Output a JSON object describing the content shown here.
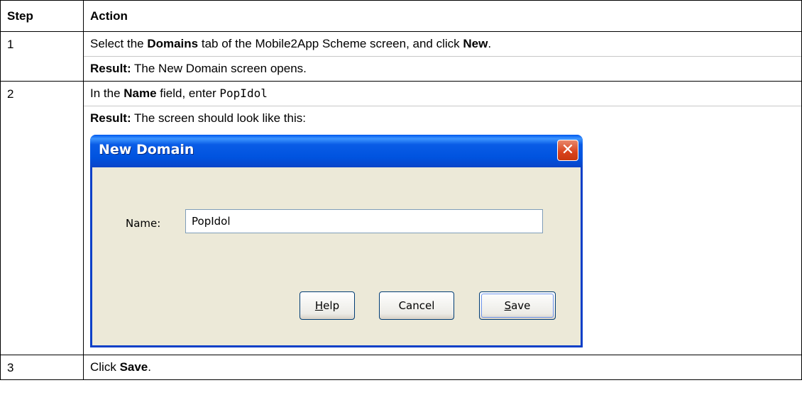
{
  "table": {
    "headers": {
      "step": "Step",
      "action": "Action"
    },
    "rows": [
      {
        "step": "1",
        "line1": {
          "pre": "Select the ",
          "b1": "Domains",
          "mid": " tab of the Mobile2App Scheme screen, and click ",
          "b2": "New",
          "post": "."
        },
        "result": {
          "label": "Result:",
          "text": " The New Domain screen opens."
        }
      },
      {
        "step": "2",
        "line1": {
          "pre": "In the ",
          "b1": "Name",
          "mid": " field, enter ",
          "code": "PopIdol"
        },
        "result": {
          "label": "Result:",
          "text": " The screen should look like this:"
        }
      },
      {
        "step": "3",
        "line1": {
          "pre": "Click ",
          "b1": "Save",
          "post": "."
        }
      }
    ]
  },
  "dialog": {
    "title": "New Domain",
    "close_icon": "close-icon",
    "close_glyph": "✕",
    "name_label": "Name:",
    "name_value": "PopIdol",
    "help_label_accel": "H",
    "help_label_rest": "elp",
    "cancel_label": "Cancel",
    "save_label_accel": "S",
    "save_label_rest": "ave",
    "colors": {
      "titlebar": "#0053df",
      "face": "#ece9d8",
      "close": "#d9421c"
    }
  }
}
